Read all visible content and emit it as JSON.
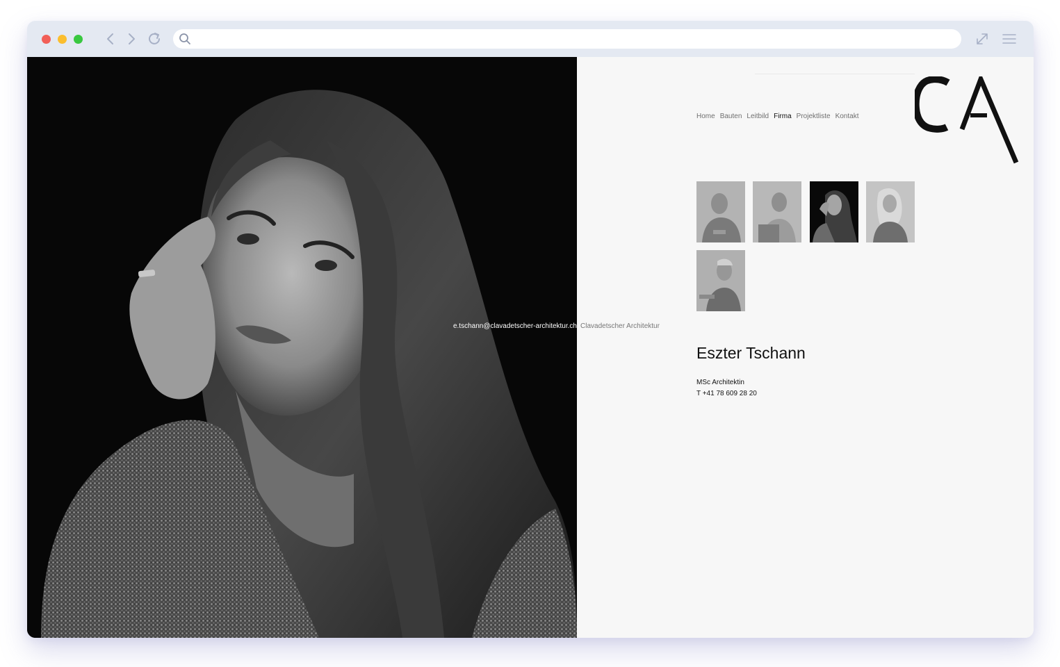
{
  "browser": {
    "address_value": "",
    "icons": [
      "back-icon",
      "forward-icon",
      "reload-icon",
      "search-icon",
      "expand-icon",
      "menu-icon"
    ]
  },
  "site": {
    "nav": [
      {
        "label": "Home",
        "active": false
      },
      {
        "label": "Bauten",
        "active": false
      },
      {
        "label": "Leitbild",
        "active": false
      },
      {
        "label": "Firma",
        "active": true
      },
      {
        "label": "Projektliste",
        "active": false
      },
      {
        "label": "Kontakt",
        "active": false
      }
    ],
    "logo_text": "CA",
    "team_thumbnails": [
      {
        "selected": false
      },
      {
        "selected": false
      },
      {
        "selected": true
      },
      {
        "selected": false
      },
      {
        "selected": false
      }
    ]
  },
  "person": {
    "email": "e.tschann@clavadetscher-architektur.ch",
    "company": "Clavadetscher Architektur",
    "name": "Eszter Tschann",
    "title": "MSc Architektin",
    "phone": "T +41 78 609 28 20"
  },
  "colors": {
    "toolbar": "#e4e9f2",
    "page_bg": "#f7f7f7",
    "active_nav": "#111111",
    "inactive_nav": "#6f6f6f"
  }
}
